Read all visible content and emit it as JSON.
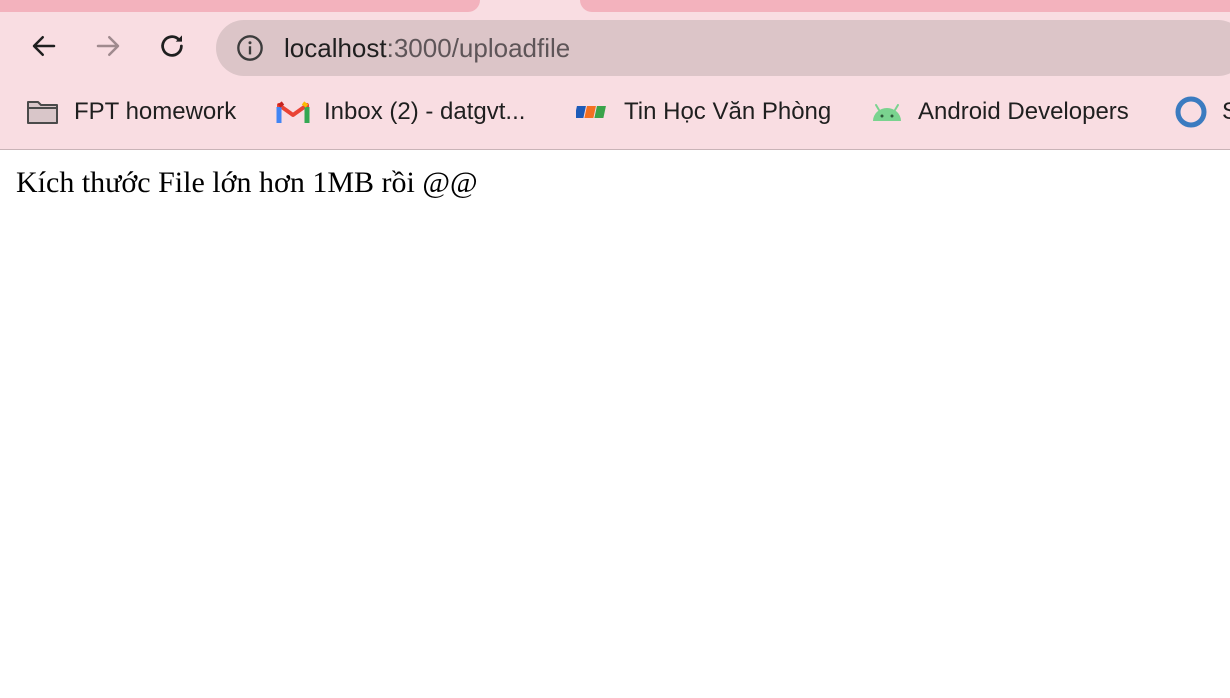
{
  "browser": {
    "address_bar": {
      "host": "localhost",
      "path": ":3000/uploadfile"
    },
    "bookmarks": [
      {
        "label": "FPT homework",
        "icon": "folder-icon"
      },
      {
        "label": "Inbox (2) - datgvt...",
        "icon": "gmail-icon"
      },
      {
        "label": "Tin Học Văn Phòng",
        "icon": "fpt-icon"
      },
      {
        "label": "Android Developers",
        "icon": "android-icon"
      },
      {
        "label": "S",
        "icon": "circle-icon"
      }
    ]
  },
  "page": {
    "message": "Kích thước File lớn hơn 1MB rồi @@"
  }
}
